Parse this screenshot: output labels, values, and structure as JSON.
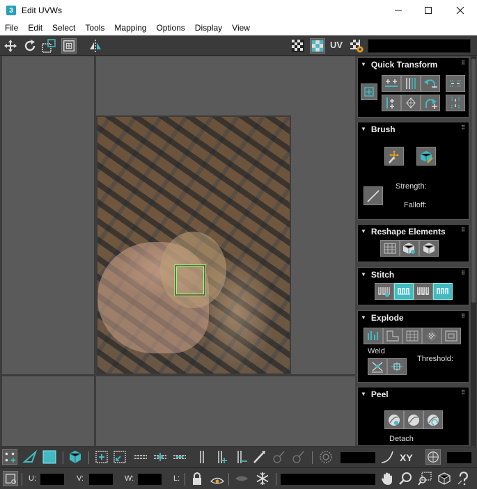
{
  "window": {
    "app_icon": "3",
    "title": "Edit UVWs",
    "minimize_icon": "minimize-icon",
    "maximize_icon": "maximize-icon",
    "close_icon": "close-icon"
  },
  "menu": [
    "File",
    "Edit",
    "Select",
    "Tools",
    "Mapping",
    "Options",
    "Display",
    "View"
  ],
  "top_toolbar": {
    "uv_label": "UV",
    "field_value": ""
  },
  "panels": {
    "quick_transform": {
      "title": "Quick Transform"
    },
    "brush": {
      "title": "Brush",
      "strength_label": "Strength:",
      "falloff_label": "Falloff:"
    },
    "reshape": {
      "title": "Reshape Elements"
    },
    "stitch": {
      "title": "Stitch"
    },
    "explode": {
      "title": "Explode",
      "weld_label": "Weld",
      "threshold_label": "Threshold:"
    },
    "peel": {
      "title": "Peel",
      "detach_label": "Detach"
    }
  },
  "bottom_toolbar": {
    "xy_label": "XY",
    "u_label": "U:",
    "v_label": "V:",
    "w_label": "W:",
    "l_label": "L:",
    "u_value": "",
    "v_value": "",
    "w_value": "",
    "angle_value": "",
    "grid_value": "",
    "selection_field": ""
  },
  "colors": {
    "accent": "#45b9c2",
    "uv_selection": "#7cf06a",
    "panel_bg": "#000000",
    "viewport_bg": "#5a5a5a"
  }
}
